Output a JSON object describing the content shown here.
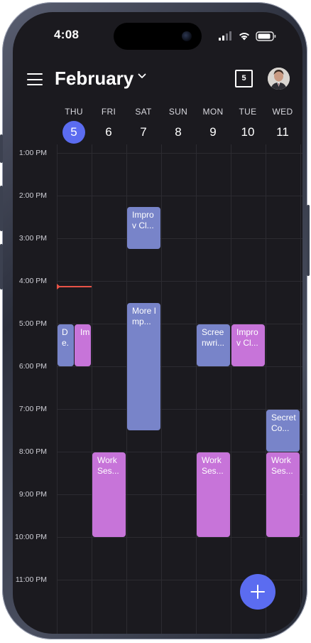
{
  "status_bar": {
    "time": "4:08"
  },
  "header": {
    "month": "February",
    "today_date": "5"
  },
  "days": [
    {
      "dow": "THU",
      "num": "5",
      "today": true
    },
    {
      "dow": "FRI",
      "num": "6"
    },
    {
      "dow": "SAT",
      "num": "7"
    },
    {
      "dow": "SUN",
      "num": "8"
    },
    {
      "dow": "MON",
      "num": "9"
    },
    {
      "dow": "TUE",
      "num": "10"
    },
    {
      "dow": "WED",
      "num": "11"
    }
  ],
  "time_labels": [
    "1:00 PM",
    "2:00 PM",
    "3:00 PM",
    "4:00 PM",
    "5:00 PM",
    "6:00 PM",
    "7:00 PM",
    "8:00 PM",
    "9:00 PM",
    "10:00 PM",
    "11:00 PM"
  ],
  "events": [
    {
      "title": "Impro v Cl...",
      "day": 2,
      "start": "2:15 PM",
      "end": "3:15 PM",
      "color": "blue"
    },
    {
      "title": "More Imp...",
      "day": 2,
      "start": "4:30 PM",
      "end": "7:30 PM",
      "color": "blue"
    },
    {
      "title": "De.",
      "day": 0,
      "start": "5:00 PM",
      "end": "6:00 PM",
      "color": "blue",
      "half": "left"
    },
    {
      "title": "Im",
      "day": 0,
      "start": "5:00 PM",
      "end": "6:00 PM",
      "color": "pink",
      "half": "right"
    },
    {
      "title": "Scree nwri...",
      "day": 4,
      "start": "5:00 PM",
      "end": "6:00 PM",
      "color": "blue"
    },
    {
      "title": "Impro v Cl...",
      "day": 5,
      "start": "5:00 PM",
      "end": "6:00 PM",
      "color": "pink"
    },
    {
      "title": "Secret Co...",
      "day": 6,
      "start": "7:00 PM",
      "end": "8:00 PM",
      "color": "blue"
    },
    {
      "title": "Work Ses...",
      "day": 1,
      "start": "8:00 PM",
      "end": "10:00 PM",
      "color": "pink"
    },
    {
      "title": "Work Ses...",
      "day": 4,
      "start": "8:00 PM",
      "end": "10:00 PM",
      "color": "pink"
    },
    {
      "title": "Work Ses...",
      "day": 6,
      "start": "8:00 PM",
      "end": "10:00 PM",
      "color": "pink"
    }
  ],
  "now_time": "4:08 PM",
  "colors": {
    "accent": "#5b6cf0",
    "event_blue": "#7884c9",
    "event_pink": "#c774d9",
    "now_line": "#e85347"
  },
  "icons": {
    "menu": "hamburger-icon",
    "month_dropdown": "chevron-down-icon",
    "today": "calendar-today-icon",
    "fab": "plus-icon"
  }
}
